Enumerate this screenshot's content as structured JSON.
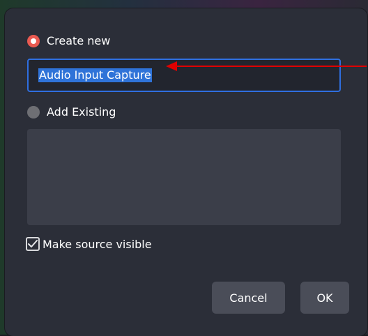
{
  "dialog": {
    "create_new_label": "Create new",
    "name_input_value": "Audio Input Capture",
    "add_existing_label": "Add Existing",
    "make_visible_label": "Make source visible",
    "make_visible_checked": true,
    "cancel_label": "Cancel",
    "ok_label": "OK"
  },
  "colors": {
    "accent_radio": "#ea5a51",
    "focus_border": "#2f6fe0",
    "annotation_arrow": "#e00000"
  },
  "icons": {
    "radio_checked": "radio-checked-icon",
    "radio_unchecked": "radio-unchecked-icon",
    "checkbox_checked": "checkmark-icon",
    "annotation": "arrow-left-icon"
  }
}
